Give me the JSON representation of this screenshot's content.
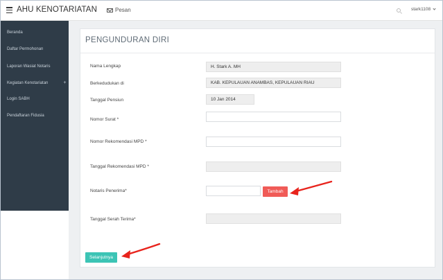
{
  "header": {
    "brand": "AHU KENOTARIATAN",
    "messages_label": "Pesan",
    "user_name": "stark1108"
  },
  "sidebar": {
    "items": [
      {
        "label": "Beranda"
      },
      {
        "label": "Daftar Permohonan"
      },
      {
        "label": "Laporan Wasiat Notaris"
      },
      {
        "label": "Kegiatan Kenotariatan",
        "expand": "+"
      },
      {
        "label": "Login SABH"
      },
      {
        "label": "Pendaftaran Fidusia"
      }
    ]
  },
  "form": {
    "title": "PENGUNDURAN DIRI",
    "fields": {
      "nama_lengkap": {
        "label": "Nama Lengkap",
        "value": "H. Stark A. MH"
      },
      "berkedudukan": {
        "label": "Berkedudukan di",
        "value": "KAB. KEPULAUAN ANAMBAS, KEPULAUAN RIAU"
      },
      "tanggal_pensiun": {
        "label": "Tanggal Pensiun",
        "value": "10 Jan 2014"
      },
      "nomor_surat": {
        "label": "Nomor Surat *",
        "value": ""
      },
      "nomor_rekomendasi": {
        "label": "Nomor Rekomendasi MPD *",
        "value": ""
      },
      "tanggal_rekomendasi": {
        "label": "Tanggal Rekomendasi MPD *",
        "value": ""
      },
      "notaris_penerima": {
        "label": "Notaris Penerima*",
        "value": ""
      },
      "tanggal_serah_terima": {
        "label": "Tanggal Serah Terima*",
        "value": ""
      }
    },
    "tambah_label": "Tambah",
    "next_label": "Selanjutnya"
  },
  "colors": {
    "sidebar_bg": "#2f3c48",
    "tambah_button": "#f05b57",
    "next_button": "#3cc4b5",
    "annotation_arrow": "#e8231c"
  },
  "icons": [
    "hamburger-icon",
    "mail-icon",
    "search-icon",
    "chevron-down-icon"
  ]
}
